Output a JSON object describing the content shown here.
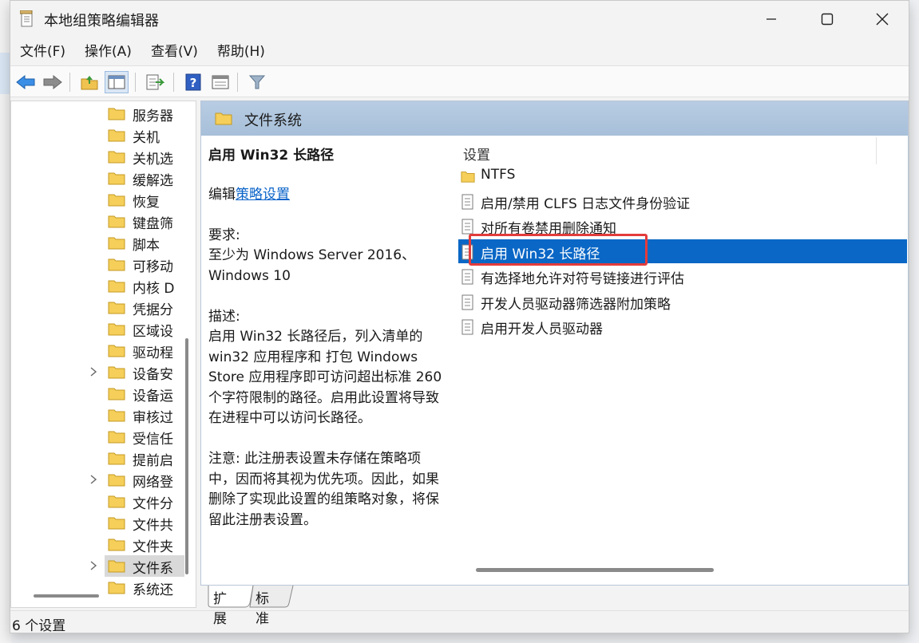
{
  "window": {
    "title": "本地组策略编辑器"
  },
  "menu": [
    "文件(F)",
    "操作(A)",
    "查看(V)",
    "帮助(H)"
  ],
  "tree": {
    "items": [
      {
        "label": "服务器",
        "expandable": false
      },
      {
        "label": "关机",
        "expandable": false
      },
      {
        "label": "关机选",
        "expandable": false
      },
      {
        "label": "缓解选",
        "expandable": false
      },
      {
        "label": "恢复",
        "expandable": false
      },
      {
        "label": "键盘筛",
        "expandable": false
      },
      {
        "label": "脚本",
        "expandable": false
      },
      {
        "label": "可移动",
        "expandable": false
      },
      {
        "label": "内核 D",
        "expandable": false
      },
      {
        "label": "凭据分",
        "expandable": false
      },
      {
        "label": "区域设",
        "expandable": false
      },
      {
        "label": "驱动程",
        "expandable": false
      },
      {
        "label": "设备安",
        "expandable": true
      },
      {
        "label": "设备运",
        "expandable": false
      },
      {
        "label": "审核过",
        "expandable": false
      },
      {
        "label": "受信任",
        "expandable": false
      },
      {
        "label": "提前启",
        "expandable": false
      },
      {
        "label": "网络登",
        "expandable": true
      },
      {
        "label": "文件分",
        "expandable": false
      },
      {
        "label": "文件共",
        "expandable": false
      },
      {
        "label": "文件夹",
        "expandable": false
      },
      {
        "label": "文件系",
        "expandable": true,
        "selected": true
      },
      {
        "label": "系统还",
        "expandable": false
      }
    ]
  },
  "panel": {
    "header": "文件系统",
    "desc_title": "启用 Win32 长路径",
    "edit_prefix": "编辑",
    "edit_link": "策略设置",
    "req_label": "要求:",
    "req_text": "至少为 Windows Server 2016、Windows 10",
    "desc_label": "描述:",
    "desc_text": "启用 Win32 长路径后，列入清单的 win32 应用程序和 打包 Windows Store 应用程序即可访问超出标准 260 个字符限制的路径。启用此设置将导致在进程中可以访问长路径。",
    "note_text": "注意: 此注册表设置未存储在策略项中，因而将其视为优先项。因此，如果删除了实现此设置的组策略对象，将保留此注册表设置。"
  },
  "list": {
    "column_header": "设置",
    "rows": [
      {
        "label": "NTFS",
        "type": "folder"
      },
      {
        "label": "启用/禁用 CLFS 日志文件身份验证",
        "type": "setting"
      },
      {
        "label": "对所有卷禁用删除通知",
        "type": "setting"
      },
      {
        "label": "启用 Win32 长路径",
        "type": "setting",
        "selected": true
      },
      {
        "label": "有选择地允许对符号链接进行评估",
        "type": "setting"
      },
      {
        "label": "开发人员驱动器筛选器附加策略",
        "type": "setting"
      },
      {
        "label": "启用开发人员驱动器",
        "type": "setting"
      }
    ]
  },
  "tabs": [
    "扩展",
    "标准"
  ],
  "status": "6 个设置",
  "colors": {
    "selection": "#0a67c6",
    "highlight_border": "#e33b3b",
    "header_bg": "#a7bfd9",
    "link": "#0a63c9"
  }
}
